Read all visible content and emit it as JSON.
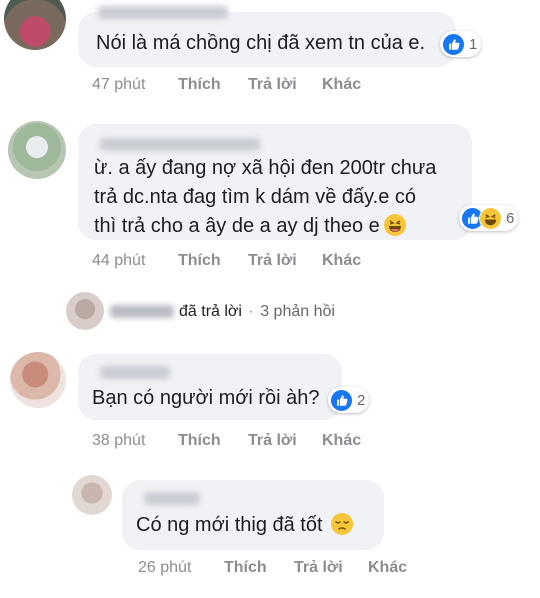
{
  "comments": [
    {
      "text_lines": [
        "Nói là má chồng chị đã xem tn của e."
      ],
      "reaction_count": "1",
      "time": "47 phút",
      "like_label": "Thích",
      "reply_label": "Trả lời",
      "more_label": "Khác"
    },
    {
      "text_lines": [
        "ừ. a ấy đang nợ xã hội đen 200tr chưa",
        "trả dc.nta đag tìm k dám về đấy.e có",
        "thì trả cho a ây de a ay dj theo e"
      ],
      "reaction_count": "6",
      "time": "44 phút",
      "like_label": "Thích",
      "reply_label": "Trả lời",
      "more_label": "Khác"
    },
    {
      "text_lines": [
        "Bạn có người mới rồi àh?"
      ],
      "reaction_count": "2",
      "time": "38 phút",
      "like_label": "Thích",
      "reply_label": "Trả lời",
      "more_label": "Khác"
    },
    {
      "text_lines": [
        "Có ng mới thig đã tốt"
      ],
      "time": "26 phút",
      "like_label": "Thích",
      "reply_label": "Trả lời",
      "more_label": "Khác"
    }
  ],
  "reply_summary": {
    "action": "đã trả lời",
    "separator": "·",
    "count": "3 phản hồi"
  },
  "icons": {
    "like": "thumbs-up-icon",
    "haha": "laughing-face-icon",
    "sad": "disappointed-face-icon"
  },
  "colors": {
    "like_blue": "#1877f2",
    "bubble_bg": "#f0f2f5",
    "meta_grey": "#8a8d91"
  }
}
